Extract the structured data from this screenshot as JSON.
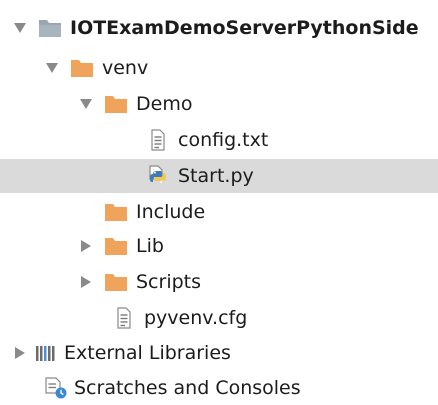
{
  "project_tree": {
    "items": [
      {
        "label": "IOTExamDemoServerPythonSide",
        "expanded": true,
        "icon": "project-folder-icon"
      },
      {
        "label": "venv",
        "expanded": true,
        "icon": "folder-icon"
      },
      {
        "label": "Demo",
        "expanded": true,
        "icon": "folder-icon"
      },
      {
        "label": "config.txt",
        "icon": "text-file-icon"
      },
      {
        "label": "Start.py",
        "icon": "python-file-icon",
        "selected": true
      },
      {
        "label": "Include",
        "icon": "folder-icon"
      },
      {
        "label": "Lib",
        "expanded": false,
        "icon": "folder-icon"
      },
      {
        "label": "Scripts",
        "expanded": false,
        "icon": "folder-icon"
      },
      {
        "label": "pyvenv.cfg",
        "icon": "text-file-icon"
      },
      {
        "label": "External Libraries",
        "expanded": false,
        "icon": "libraries-icon"
      },
      {
        "label": "Scratches and Consoles",
        "icon": "scratches-icon"
      }
    ]
  },
  "colors": {
    "folder": "#f0a35a",
    "selection": "#dadada",
    "arrow": "#8a8a8a",
    "text": "#1c1c1c"
  }
}
